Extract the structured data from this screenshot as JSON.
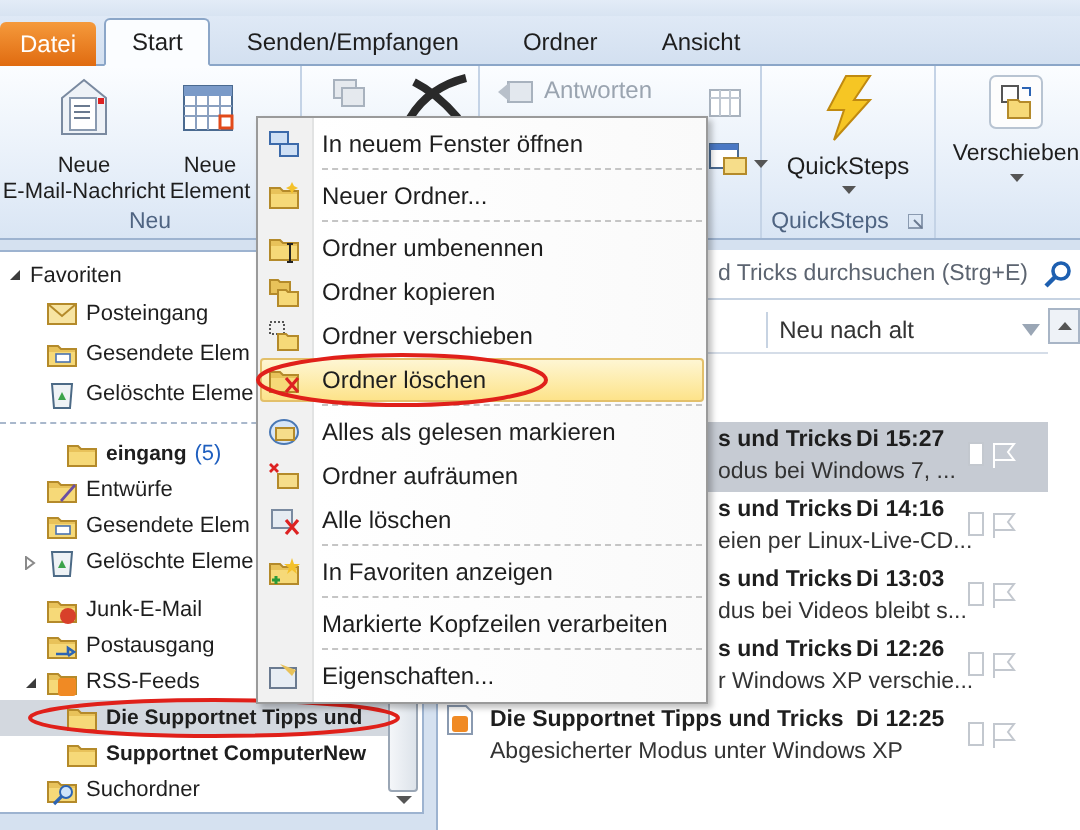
{
  "tabs": [
    {
      "label": "Datei",
      "kind": "file",
      "selected": false
    },
    {
      "label": "Start",
      "kind": "tab",
      "selected": true
    },
    {
      "label": "Senden/Empfangen",
      "kind": "tab",
      "selected": false
    },
    {
      "label": "Ordner",
      "kind": "tab",
      "selected": false
    },
    {
      "label": "Ansicht",
      "kind": "tab",
      "selected": false
    }
  ],
  "ribbon": {
    "new_group": {
      "label": "Neu",
      "buttons": [
        {
          "lines": [
            "Neue",
            "E-Mail-Nachricht"
          ]
        },
        {
          "lines": [
            "Neue",
            "Element"
          ]
        }
      ]
    },
    "reply_button": {
      "label": "Antworten",
      "disabled": true
    },
    "quicksteps": {
      "button": "QuickSteps",
      "label": "QuickSteps"
    },
    "move_button": "Verschieben"
  },
  "favorites": {
    "label": "Favoriten",
    "expanded": true,
    "children": [
      {
        "label": "Posteingang",
        "selected": false,
        "unread": false
      },
      {
        "label": "Gesendete Elem",
        "selected": false,
        "unread": false
      },
      {
        "label": "Gelöschte Eleme",
        "selected": false,
        "unread": false
      }
    ]
  },
  "folders": [
    {
      "label": "eingang",
      "count": "(5)",
      "selected": false,
      "unread": true
    },
    {
      "label": "Entwürfe",
      "selected": false,
      "unread": false
    },
    {
      "label": "Gesendete Elem",
      "selected": false,
      "unread": false
    },
    {
      "label": "Gelöschte Eleme",
      "selected": false,
      "unread": false,
      "expanded": false
    },
    {
      "label": "Junk-E-Mail",
      "selected": false,
      "unread": false
    },
    {
      "label": "Postausgang",
      "selected": false,
      "unread": false
    },
    {
      "label": "RSS-Feeds",
      "selected": false,
      "unread": false,
      "expanded": true,
      "children": [
        {
          "label": "Die Supportnet Tipps und",
          "selected": true,
          "unread": true
        },
        {
          "label": "Supportnet ComputerNew",
          "selected": false,
          "unread": true
        }
      ]
    },
    {
      "label": "Suchordner",
      "selected": false,
      "unread": false
    }
  ],
  "search": {
    "placeholder": "d Tricks durchsuchen (Strg+E)"
  },
  "sort": {
    "label": "Neu nach alt"
  },
  "messages": [
    {
      "kind": "clipped",
      "sender": "s und Tricks",
      "time": "Di 15:27",
      "preview": "odus bei Windows 7, ...",
      "selected": true
    },
    {
      "kind": "clipped",
      "sender": "s und Tricks",
      "time": "Di 14:16",
      "preview": "eien per Linux-Live-CD...",
      "selected": false
    },
    {
      "kind": "clipped",
      "sender": "s und Tricks",
      "time": "Di 13:03",
      "preview": "dus bei Videos bleibt s...",
      "selected": false
    },
    {
      "kind": "clipped",
      "sender": "s und Tricks",
      "time": "Di 12:26",
      "preview": "r Windows XP verschie...",
      "selected": false
    },
    {
      "kind": "full",
      "sender": "Die Supportnet Tipps und Tricks",
      "time": "Di 12:25",
      "preview": "Abgesicherter Modus unter Windows XP",
      "selected": false
    }
  ],
  "context_menu": [
    {
      "label": "In neuem Fenster öffnen",
      "selected": false,
      "separator_after": true
    },
    {
      "label": "Neuer Ordner...",
      "selected": false,
      "separator_after": true
    },
    {
      "label": "Ordner umbenennen",
      "selected": false,
      "separator_after": false
    },
    {
      "label": "Ordner kopieren",
      "selected": false,
      "separator_after": false
    },
    {
      "label": "Ordner verschieben",
      "selected": false,
      "separator_after": false
    },
    {
      "label": "Ordner löschen",
      "selected": true,
      "separator_after": true
    },
    {
      "label": "Alles als gelesen markieren",
      "selected": false,
      "separator_after": false
    },
    {
      "label": "Ordner aufräumen",
      "selected": false,
      "separator_after": false
    },
    {
      "label": "Alle löschen",
      "selected": false,
      "separator_after": true
    },
    {
      "label": "In Favoriten anzeigen",
      "selected": false,
      "separator_after": true
    },
    {
      "label": "Markierte Kopfzeilen verarbeiten",
      "selected": false,
      "separator_after": true
    },
    {
      "label": "Eigenschaften...",
      "selected": false,
      "separator_after": false
    }
  ]
}
